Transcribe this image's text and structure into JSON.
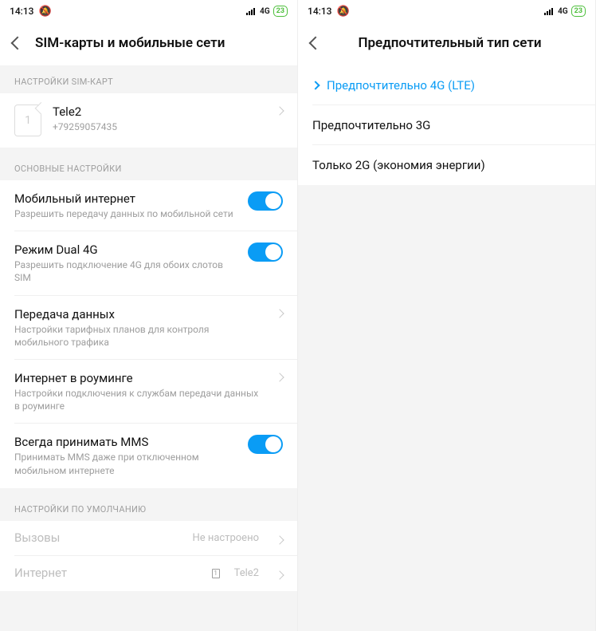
{
  "status": {
    "time": "14:13",
    "network_label": "4G",
    "battery_text": "23"
  },
  "screen_left": {
    "title": "SIM-карты и мобильные сети",
    "section_sim": "НАСТРОЙКИ SIM-КАРТ",
    "sim": {
      "slot": "1",
      "carrier": "Tele2",
      "number": "+79259057435"
    },
    "section_main": "ОСНОВНЫЕ НАСТРОЙКИ",
    "mobile_data": {
      "title": "Мобильный интернет",
      "sub": "Разрешить передачу данных по мобильной сети"
    },
    "dual4g": {
      "title": "Режим Dual 4G",
      "sub": "Разрешить подключение 4G для обоих слотов SIM"
    },
    "data_usage": {
      "title": "Передача данных",
      "sub": "Настройки тарифных планов для контроля мобильного трафика"
    },
    "roaming": {
      "title": "Интернет в роуминге",
      "sub": "Настройки подключения к службам передачи данных в роуминге"
    },
    "mms": {
      "title": "Всегда принимать MMS",
      "sub": "Принимать MMS даже при отключенном мобильном интернете"
    },
    "section_default": "НАСТРОЙКИ ПО УМОЛЧАНИЮ",
    "calls": {
      "title": "Вызовы",
      "value": "Не настроено"
    },
    "internet": {
      "title": "Интернет",
      "sim_index": "1",
      "value": "Tele2"
    }
  },
  "screen_right": {
    "title": "Предпочтительный тип сети",
    "options": [
      "Предпочтительно 4G (LTE)",
      "Предпочтительно 3G",
      "Только 2G (экономия энергии)"
    ]
  }
}
